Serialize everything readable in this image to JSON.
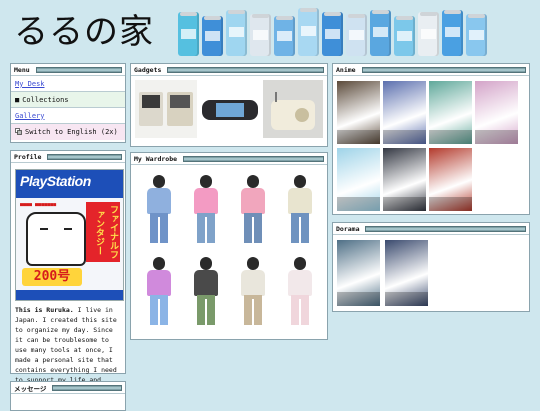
{
  "site": {
    "title": "るるの家"
  },
  "header": {
    "can_colors": [
      "#55c0e0",
      "#3f8fd8",
      "#9fd6f0",
      "#dfe7ee",
      "#6fb3e6",
      "#a8d8f2",
      "#3f8fd8",
      "#cfe2f1",
      "#5aa7e0",
      "#7cc8ea",
      "#e9eef2",
      "#4aa0e2",
      "#89c7ee"
    ]
  },
  "menu": {
    "title": "Menu",
    "items": [
      {
        "label": "My Desk"
      },
      {
        "label": "Collections",
        "bullet": "■"
      },
      {
        "label": "Gallery"
      },
      {
        "label": "Switch to English (2x)"
      }
    ]
  },
  "profile": {
    "title": "Profile",
    "magazine": {
      "logo": "PlayStation",
      "side_text": "ファイナルファンタジー",
      "issue": "200号"
    },
    "bio_name": "This is Ruruka.",
    "bio_text": " I live in Japan. I created this site to organize my day. Since it can be troublesome to use many tools at once, I made a personal site that contains everything I need to support my life and studies."
  },
  "message": {
    "title": "メッセージ"
  },
  "gadgets": {
    "title": "Gadgets"
  },
  "wardrobe": {
    "title": "My Wardrobe",
    "outfits": [
      {
        "top": "#8fb0de",
        "legs": "#6f93c8"
      },
      {
        "top": "#f39bc3",
        "legs": "#7fa2c9"
      },
      {
        "top": "#f1a6bd",
        "legs": "#6f8fb8"
      },
      {
        "top": "#e8e4cf",
        "legs": "#6f93c0"
      },
      {
        "top": "#d08adc",
        "legs": "#8bb4e6"
      },
      {
        "top": "#4a4a4a",
        "legs": "#7a9a6a"
      },
      {
        "top": "#e9e6dc",
        "legs": "#c8b79a"
      },
      {
        "top": "#f2e8ea",
        "legs": "#f0d6dc"
      }
    ]
  },
  "anime": {
    "title": "Anime",
    "posters": [
      "#5b4a3a",
      "#5b6fae",
      "#5fa89a",
      "#d3a3c8",
      "#9ed3e8",
      "#333742",
      "#b33a2c"
    ]
  },
  "dorama": {
    "title": "Dorama",
    "posters": [
      "#4e6f86",
      "#3a4a6e"
    ]
  }
}
